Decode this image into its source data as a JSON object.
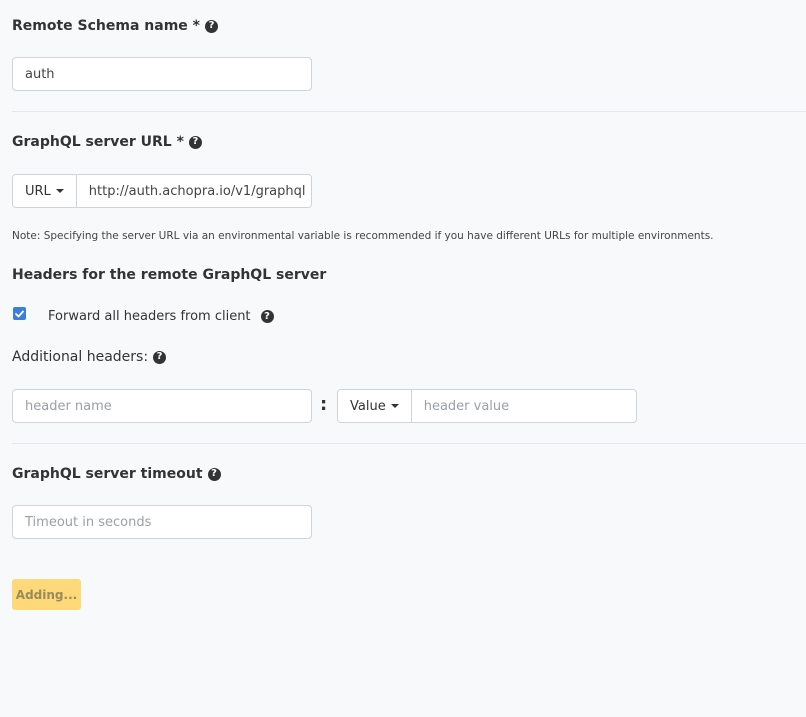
{
  "schema_name": {
    "label": "Remote Schema name *",
    "value": "auth"
  },
  "server_url": {
    "label": "GraphQL server URL *",
    "type_dropdown": "URL",
    "value": "http://auth.achopra.io/v1/graphql",
    "note": "Note: Specifying the server URL via an environmental variable is recommended if you have different URLs for multiple environments."
  },
  "headers": {
    "title": "Headers for the remote GraphQL server",
    "forward_label": "Forward all headers from client",
    "forward_checked": true,
    "additional_label": "Additional headers:",
    "name_placeholder": "header name",
    "separator": ":",
    "value_type_dropdown": "Value",
    "value_placeholder": "header value"
  },
  "timeout": {
    "label": "GraphQL server timeout",
    "placeholder": "Timeout in seconds"
  },
  "submit": {
    "label": "Adding..."
  },
  "icons": {
    "help": "question-circle-icon",
    "dropdown": "caret-down-icon",
    "check": "check-icon"
  },
  "colors": {
    "background": "#f8f9fb",
    "checkbox": "#3c7fd9",
    "button": "#fdd97a"
  }
}
